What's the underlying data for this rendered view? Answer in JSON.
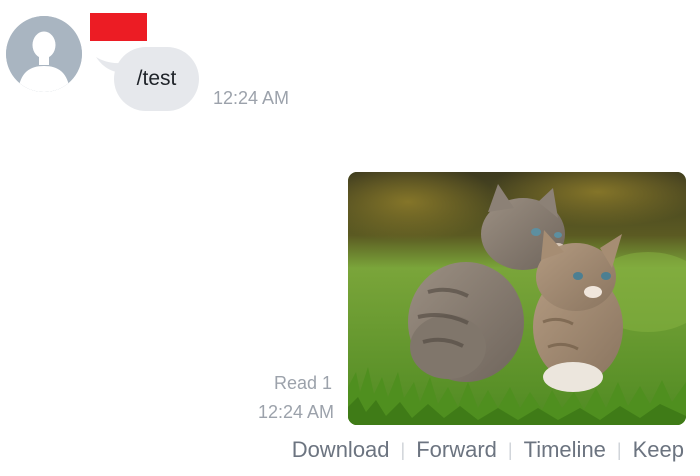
{
  "incoming": {
    "text": "/test",
    "time": "12:24 AM"
  },
  "outgoing": {
    "read_label": "Read 1",
    "time": "12:24 AM",
    "image_icon": "photo-two-kittens"
  },
  "actions": {
    "download": "Download",
    "forward": "Forward",
    "timeline": "Timeline",
    "keep": "Keep",
    "separator": "|"
  },
  "colors": {
    "redaction": "#ec1c24",
    "bubble": "#e6e8ec",
    "avatar": "#a9b5c1"
  }
}
